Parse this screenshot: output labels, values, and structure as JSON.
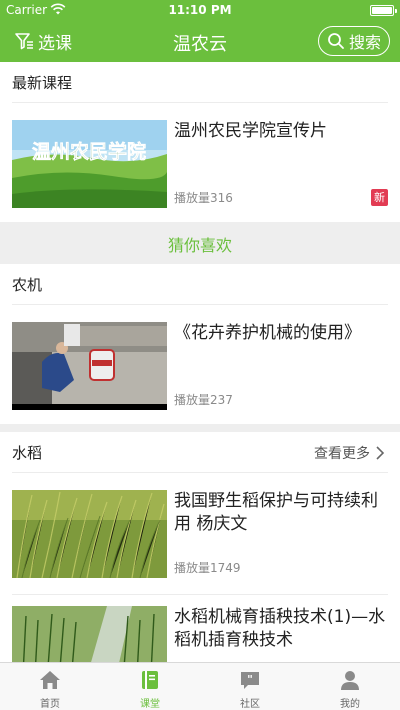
{
  "status_bar": {
    "carrier": "Carrier",
    "time": "11:10 PM"
  },
  "nav": {
    "filter_label": "选课",
    "title": "温农云",
    "search_label": "搜索"
  },
  "latest": {
    "title": "最新课程",
    "item": {
      "title": "温州农民学院宣传片",
      "plays": "播放量316",
      "badge": "新",
      "thumb_text": "温州农民学院"
    }
  },
  "guess": {
    "label": "猜你喜欢"
  },
  "sections": [
    {
      "title": "农机",
      "items": [
        {
          "title": "《花卉养护机械的使用》",
          "plays": "播放量237"
        }
      ]
    },
    {
      "title": "水稻",
      "more": "查看更多",
      "items": [
        {
          "title": "我国野生稻保护与可持续利用 杨庆文",
          "plays": "播放量1749"
        },
        {
          "title": "水稻机械育插秧技术(1)—水稻机插育秧技术",
          "plays": ""
        }
      ]
    }
  ],
  "tabbar": {
    "tabs": [
      {
        "label": "首页",
        "icon": "home-icon"
      },
      {
        "label": "课堂",
        "icon": "book-icon",
        "active": true
      },
      {
        "label": "社区",
        "icon": "chat-quote-icon"
      },
      {
        "label": "我的",
        "icon": "user-icon"
      }
    ]
  },
  "colors": {
    "brand": "#6bbf3d",
    "badge": "#e23b53",
    "gray_bg": "#eeeeee"
  }
}
